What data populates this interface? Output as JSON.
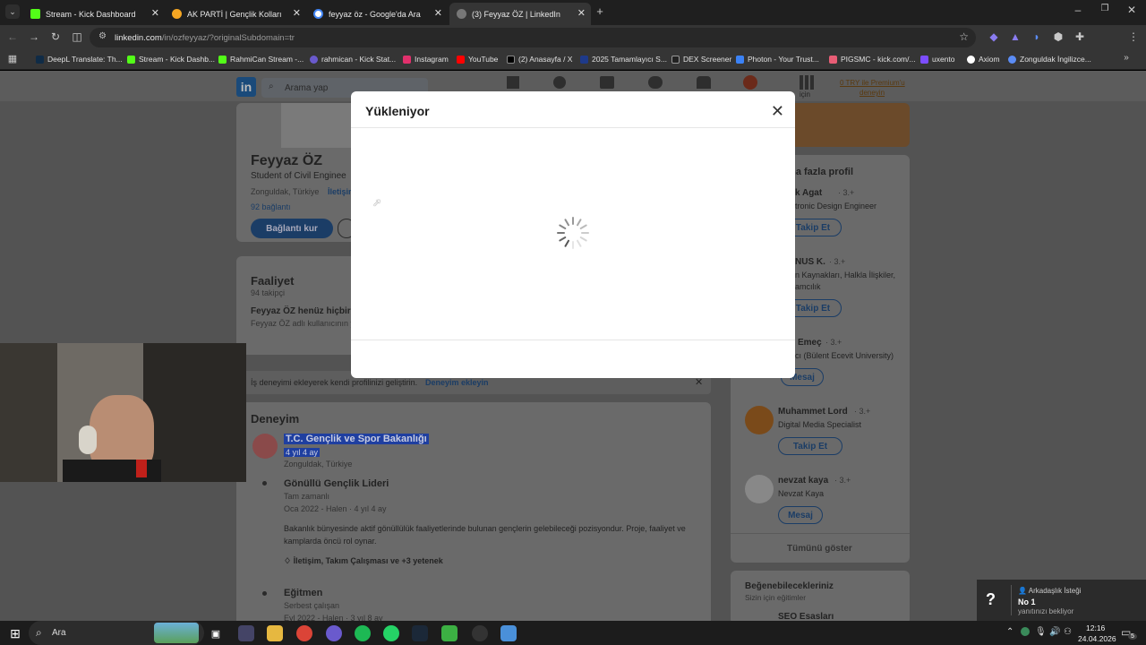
{
  "browser": {
    "tabs": [
      {
        "title": "Stream - Kick Dashboard",
        "color": "#53fc18"
      },
      {
        "title": "AK PARTİ | Gençlik Kolları",
        "color": "#f5a623"
      },
      {
        "title": "feyyaz öz - Google'da Ara",
        "color": "#4285f4"
      },
      {
        "title": "(3) Feyyaz ÖZ | LinkedIn",
        "color": "#888888"
      }
    ],
    "url_host": "linkedin.com",
    "url_path": "/in/ozfeyyaz/?originalSubdomain=tr",
    "bookmarks": [
      "DeepL Translate: Th...",
      "Stream - Kick Dashb...",
      "RahmiCan Stream -...",
      "rahmican - Kick Stat...",
      "Instagram",
      "YouTube",
      "(2) Anasayfa / X",
      "2025 Tamamlayıcı S...",
      "DEX Screener",
      "Photon - Your Trust...",
      "PIGSMC - kick.com/...",
      "uxento",
      "Axiom",
      "Zonguldak İngilizce..."
    ]
  },
  "linkedin": {
    "search_placeholder": "Arama yap",
    "premium_line1": "0 TRY ile Premium'u",
    "premium_line2": "deneyin",
    "nav_me": "için",
    "profile": {
      "name": "Feyyaz ÖZ",
      "headline": "Student of Civil Enginee",
      "location": "Zonguldak, Türkiye",
      "contact": "İletişim",
      "connections": "92 bağlantı",
      "connect_button": "Bağlantı kur"
    },
    "activity": {
      "title": "Faaliyet",
      "followers": "94 takipçi",
      "empty_title": "Feyyaz ÖZ henüz hiçbir",
      "empty_sub": "Feyyaz ÖZ adlı kullanıcının y"
    },
    "experience_hint": "İş deneyimi ekleyerek kendi profilinizi geliştirin.",
    "experience_link": "Deneyim ekleyin",
    "experience": {
      "title": "Deneyim",
      "org": "T.C. Gençlik ve Spor Bakanlığı",
      "duration": "4 yıl 4 ay",
      "location": "Zonguldak, Türkiye",
      "roles": [
        {
          "title": "Gönüllü Gençlik Lideri",
          "type": "Tam zamanlı",
          "dates": "Oca 2022 - Halen · 4 yıl 4 ay",
          "description": "Bakanlık bünyesinde aktif gönüllülük faaliyetlerinde bulunan gençlerin gelebileceği pozisyondur. Proje, faaliyet ve kamplarda öncü rol oynar.",
          "skills": "İletişim, Takım Çalışması ve +3 yetenek"
        },
        {
          "title": "Eğitmen",
          "type": "Serbest çalışan",
          "dates": "Eyl 2022 - Halen · 3 yıl 8 ay"
        }
      ]
    },
    "sidebar": {
      "title": "aha fazla profil",
      "people": [
        {
          "name": "k Agat",
          "degree": "· 3.+",
          "desc": "tronic Design Engineer",
          "button": "Takip Et"
        },
        {
          "name": "NUS K.",
          "degree": "· 3.+",
          "desc": "n Kaynakları, Halkla İlişkiler,",
          "desc2": "amcılık",
          "button": "Takip Et"
        },
        {
          "name": "Emeç",
          "degree": "· 3.+",
          "desc": "cı (Bülent Ecevit University)",
          "button": "Mesaj"
        },
        {
          "name": "Muhammet Lord",
          "degree": "· 3.+",
          "desc": "Digital Media Specialist",
          "button": "Takip Et"
        },
        {
          "name": "nevzat kaya",
          "degree": "· 3.+",
          "desc": "Nevzat Kaya",
          "button": "Mesaj"
        }
      ],
      "show_all": "Tümünü göster",
      "courses_title": "Beğenebilecekleriniz",
      "courses_sub": "Sizin için eğitimler",
      "course_item": "SEO Esasları"
    }
  },
  "modal": {
    "title": "Yükleniyor"
  },
  "notification": {
    "title": "Arkadaşlık İsteği",
    "name": "No 1",
    "status": "yanıtınızı bekliyor"
  },
  "taskbar": {
    "search": "Ara",
    "time": "12:16",
    "date": "24.04.2026",
    "notif_count": "5"
  }
}
